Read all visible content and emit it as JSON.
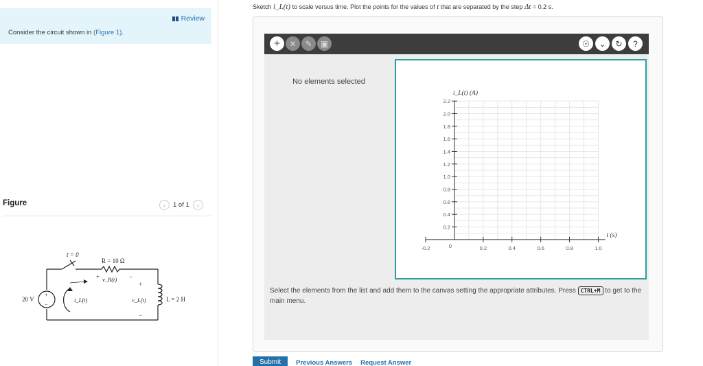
{
  "left": {
    "review_label": "Review",
    "problem_prefix": "Consider the circuit shown in ",
    "problem_link": "(Figure 1)",
    "problem_suffix": ".",
    "figure_heading": "Figure",
    "pager_text": "1 of 1",
    "pager_prev_icon": "chevron-left-icon",
    "pager_next_icon": "chevron-right-icon"
  },
  "circuit": {
    "switch_label": "t = 0",
    "resistor_label": "R = 10 Ω",
    "vr_label": "v_R(t)",
    "plus_label": "+",
    "minus_label": "−",
    "source_label": "20 V",
    "il_label": "i_L(t)",
    "vl_label": "v_L(t)",
    "inductor_label": "L = 2 H"
  },
  "instruction": {
    "prefix": "Sketch ",
    "var": "i_L(t)",
    "middle": " to scale versus time. Plot the points for the values of ",
    "t": "t",
    "suffix": " that are separated by the step ",
    "delta": "Δt",
    "step": " = 0.2 s."
  },
  "toolbar": {
    "add_icon": "plus-icon",
    "icons_left": [
      "point-tool-icon",
      "edit-tool-icon",
      "delete-icon"
    ],
    "icons_right": [
      "hint-icon",
      "dropdown-icon",
      "reset-icon",
      "help-icon"
    ]
  },
  "side_panel": {
    "empty_text": "No elements selected"
  },
  "chart_data": {
    "type": "scatter",
    "ylabel": "i_L(t) (A)",
    "xlabel": "t (s)",
    "xlim": [
      -0.3,
      1.05
    ],
    "ylim": [
      -0.1,
      2.3
    ],
    "grid": true,
    "x_ticks": [
      "-0.2",
      "0",
      "0.2",
      "0.4",
      "0.6",
      "0.8",
      "1.0"
    ],
    "y_ticks": [
      "0.2",
      "0.4",
      "0.6",
      "0.8",
      "1.0",
      "1.2",
      "1.4",
      "1.6",
      "1.8",
      "2.0",
      "2.2"
    ],
    "points": []
  },
  "help": {
    "text_before": "Select the elements from the list and add them to the canvas setting the appropriate attributes. Press ",
    "shortcut": "CTRL+M",
    "text_after": " to get to the main menu."
  },
  "actions": {
    "submit": "Submit",
    "previous_answers": "Previous Answers",
    "request_answer": "Request Answer"
  },
  "colors": {
    "accent": "#2aa0a0",
    "link": "#2470a8",
    "toolbar": "#3d3d3d",
    "review_bg": "#e3f5fa"
  }
}
